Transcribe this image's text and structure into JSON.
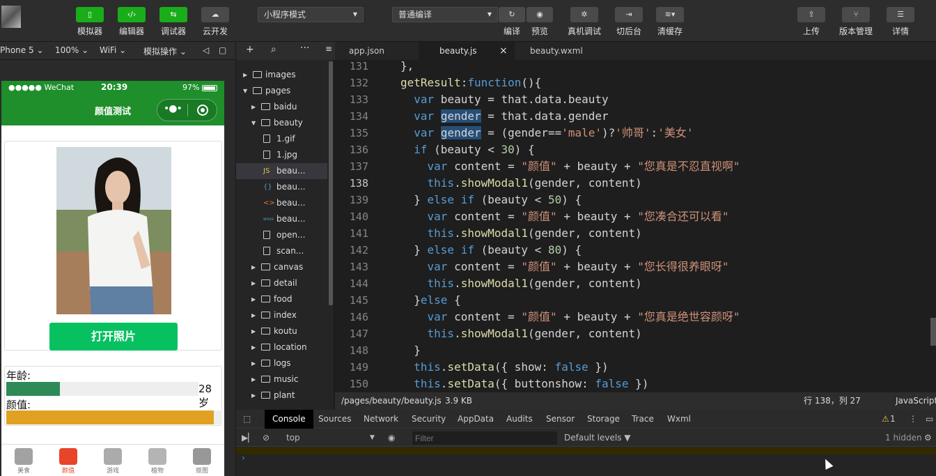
{
  "toolbar": {
    "buttons": [
      {
        "label": "模拟器",
        "glyph": "▯"
      },
      {
        "label": "编辑器",
        "glyph": "‹/›"
      },
      {
        "label": "调试器",
        "glyph": "⇆"
      },
      {
        "label": "云开发",
        "glyph": "☁"
      }
    ],
    "mode_select": "小程序模式",
    "compile_select": "普通编译",
    "compile_btn": "编译",
    "preview_btn": "预览",
    "real_debug": "真机调试",
    "backstage": "切后台",
    "clear_cache": "清缓存",
    "upload": "上传",
    "version": "版本管理",
    "details": "详情"
  },
  "devbar": {
    "device": "Phone 5",
    "zoom": "100%",
    "network": "WiFi",
    "sim_ops": "模拟操作"
  },
  "phone": {
    "carrier": "●●●●● WeChat",
    "time": "20:39",
    "battery": "97%",
    "title": "颜值测试",
    "open_photo": "打开照片",
    "age_label": "年龄:",
    "age_value": "28岁",
    "age_fraction": 0.28,
    "beauty_label": "颜值:",
    "beauty_fraction": 0.96,
    "tabs": [
      {
        "label": "美食",
        "color": "#555"
      },
      {
        "label": "颜值",
        "color": "#e8442a"
      },
      {
        "label": "游戏",
        "color": "#666"
      },
      {
        "label": "植物",
        "color": "#777"
      },
      {
        "label": "抠图",
        "color": "#444"
      }
    ]
  },
  "explorer": {
    "items": [
      {
        "name": "images",
        "type": "folder",
        "open": false,
        "depth": 0
      },
      {
        "name": "pages",
        "type": "folder",
        "open": true,
        "depth": 0
      },
      {
        "name": "baidu",
        "type": "folder",
        "open": false,
        "depth": 1
      },
      {
        "name": "beauty",
        "type": "folder",
        "open": true,
        "depth": 1
      },
      {
        "name": "1.gif",
        "type": "file",
        "depth": 2
      },
      {
        "name": "1.jpg",
        "type": "file",
        "depth": 2
      },
      {
        "name": "beau...",
        "type": "js",
        "depth": 2,
        "selected": true
      },
      {
        "name": "beau...",
        "type": "css",
        "depth": 2
      },
      {
        "name": "beau...",
        "type": "wxml",
        "depth": 2
      },
      {
        "name": "beau...",
        "type": "wxss",
        "depth": 2
      },
      {
        "name": "open...",
        "type": "file",
        "depth": 2
      },
      {
        "name": "scan...",
        "type": "file",
        "depth": 2
      },
      {
        "name": "canvas",
        "type": "folder",
        "open": false,
        "depth": 1
      },
      {
        "name": "detail",
        "type": "folder",
        "open": false,
        "depth": 1
      },
      {
        "name": "food",
        "type": "folder",
        "open": false,
        "depth": 1
      },
      {
        "name": "index",
        "type": "folder",
        "open": false,
        "depth": 1
      },
      {
        "name": "koutu",
        "type": "folder",
        "open": false,
        "depth": 1
      },
      {
        "name": "location",
        "type": "folder",
        "open": false,
        "depth": 1
      },
      {
        "name": "logs",
        "type": "folder",
        "open": false,
        "depth": 1
      },
      {
        "name": "music",
        "type": "folder",
        "open": false,
        "depth": 1
      },
      {
        "name": "plant",
        "type": "folder",
        "open": false,
        "depth": 1
      }
    ]
  },
  "tabs": [
    {
      "label": "app.json"
    },
    {
      "label": "beauty.js",
      "active": true,
      "close": "×"
    },
    {
      "label": "beauty.wxml"
    }
  ],
  "editor": {
    "lines": [
      {
        "num": "131",
        "text": "},"
      },
      {
        "num": "132",
        "text": "getResult:function(){"
      },
      {
        "num": "133",
        "text": "  var beauty = that.data.beauty"
      },
      {
        "num": "134",
        "text": "  var gender = that.data.gender"
      },
      {
        "num": "135",
        "text": "  var gender = (gender=='male')?'帅哥':'美女'"
      },
      {
        "num": "136",
        "text": "  if (beauty < 30) {"
      },
      {
        "num": "137",
        "text": "    var content = \"颜值\" + beauty + \"您真是不忍直视啊\""
      },
      {
        "num": "138",
        "text": "    this.showModal1(gender, content)",
        "current": true
      },
      {
        "num": "139",
        "text": "  } else if (beauty < 50) {"
      },
      {
        "num": "140",
        "text": "    var content = \"颜值\" + beauty + \"您凑合还可以看\""
      },
      {
        "num": "141",
        "text": "    this.showModal1(gender, content)"
      },
      {
        "num": "142",
        "text": "  } else if (beauty < 80) {"
      },
      {
        "num": "143",
        "text": "    var content = \"颜值\" + beauty + \"您长得很养眼呀\""
      },
      {
        "num": "144",
        "text": "    this.showModal1(gender, content)"
      },
      {
        "num": "145",
        "text": "  }else {"
      },
      {
        "num": "146",
        "text": "    var content = \"颜值\" + beauty + \"您真是绝世容颜呀\""
      },
      {
        "num": "147",
        "text": "    this.showModal1(gender, content)"
      },
      {
        "num": "148",
        "text": "  }"
      },
      {
        "num": "149",
        "text": "  this.setData({ show: false })"
      },
      {
        "num": "150",
        "text": "  this.setData({ buttonshow: false })"
      }
    ]
  },
  "status": {
    "path": "/pages/beauty/beauty.js",
    "size": "3.9 KB",
    "position": "行 138，列 27",
    "lang": "JavaScript"
  },
  "devtools": {
    "tabs": [
      "Console",
      "Sources",
      "Network",
      "Security",
      "AppData",
      "Audits",
      "Sensor",
      "Storage",
      "Trace",
      "Wxml"
    ],
    "warn_count": "1",
    "context": "top",
    "filter_placeholder": "Filter",
    "levels": "Default levels ▼",
    "hidden": "1 hidden",
    "prompt": "›"
  }
}
